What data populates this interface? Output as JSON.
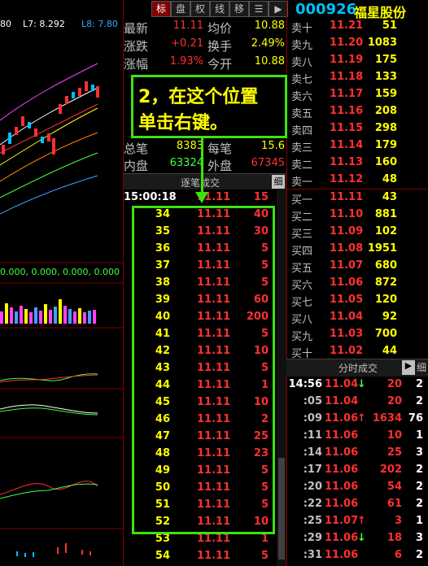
{
  "chart_header": {
    "v1": "80",
    "l7": "L7: 8.292",
    "l8": "L8: 7.80"
  },
  "chart_indicator_text": "0.000, 0.000, 0.000, 0.000",
  "toolbar": {
    "tabs": [
      "标",
      "盘",
      "权",
      "线",
      "移",
      "",
      ""
    ]
  },
  "stock": {
    "code": "000926",
    "name": "福星股份"
  },
  "quote": [
    {
      "l1": "最新",
      "v1": "11.11",
      "c1": "#ff3030",
      "l2": "均价",
      "v2": "10.88",
      "c2": "#ffff00"
    },
    {
      "l1": "涨跌",
      "v1": "+0.21",
      "c1": "#ff3030",
      "l2": "换手",
      "v2": "2.49%",
      "c2": "#ffff00"
    },
    {
      "l1": "涨幅",
      "v1": "1.93%",
      "c1": "#ff3030",
      "l2": "今开",
      "v2": "10.88",
      "c2": "#ffff00"
    },
    {
      "l1": "总笔",
      "v1": "8383",
      "c1": "#ffff00",
      "l2": "每笔",
      "v2": "15.6",
      "c2": "#ffff00"
    },
    {
      "l1": "内盘",
      "v1": "63324",
      "c1": "#40ff40",
      "l2": "外盘",
      "v2": "67345",
      "c2": "#ff3030"
    }
  ],
  "tick_header": {
    "title": "逐笔成交",
    "detail": "细"
  },
  "tick_first": {
    "time": "15:00:18",
    "price": "11.11",
    "vol": "15"
  },
  "ticks": [
    {
      "t": "34",
      "p": "11.11",
      "v": "40"
    },
    {
      "t": "35",
      "p": "11.11",
      "v": "30"
    },
    {
      "t": "36",
      "p": "11.11",
      "v": "5"
    },
    {
      "t": "37",
      "p": "11.11",
      "v": "5"
    },
    {
      "t": "38",
      "p": "11.11",
      "v": "5"
    },
    {
      "t": "39",
      "p": "11.11",
      "v": "60"
    },
    {
      "t": "40",
      "p": "11.11",
      "v": "200"
    },
    {
      "t": "41",
      "p": "11.11",
      "v": "5"
    },
    {
      "t": "42",
      "p": "11.11",
      "v": "10"
    },
    {
      "t": "43",
      "p": "11.11",
      "v": "5"
    },
    {
      "t": "44",
      "p": "11.11",
      "v": "1"
    },
    {
      "t": "45",
      "p": "11.11",
      "v": "10"
    },
    {
      "t": "46",
      "p": "11.11",
      "v": "2"
    },
    {
      "t": "47",
      "p": "11.11",
      "v": "25"
    },
    {
      "t": "48",
      "p": "11.11",
      "v": "23"
    },
    {
      "t": "49",
      "p": "11.11",
      "v": "5"
    },
    {
      "t": "50",
      "p": "11.11",
      "v": "5"
    },
    {
      "t": "51",
      "p": "11.11",
      "v": "5"
    },
    {
      "t": "52",
      "p": "11.11",
      "v": "10"
    },
    {
      "t": "53",
      "p": "11.11",
      "v": "1"
    },
    {
      "t": "54",
      "p": "11.11",
      "v": "5"
    }
  ],
  "orderbook": [
    {
      "label": "卖十",
      "price": "11.21",
      "vol": "51"
    },
    {
      "label": "卖九",
      "price": "11.20",
      "vol": "1083"
    },
    {
      "label": "卖八",
      "price": "11.19",
      "vol": "175"
    },
    {
      "label": "卖七",
      "price": "11.18",
      "vol": "133"
    },
    {
      "label": "卖六",
      "price": "11.17",
      "vol": "159"
    },
    {
      "label": "卖五",
      "price": "11.16",
      "vol": "208"
    },
    {
      "label": "卖四",
      "price": "11.15",
      "vol": "298"
    },
    {
      "label": "卖三",
      "price": "11.14",
      "vol": "179"
    },
    {
      "label": "卖二",
      "price": "11.13",
      "vol": "160"
    },
    {
      "label": "卖一",
      "price": "11.12",
      "vol": "48"
    },
    {
      "label": "买一",
      "price": "11.11",
      "vol": "43"
    },
    {
      "label": "买二",
      "price": "11.10",
      "vol": "881"
    },
    {
      "label": "买三",
      "price": "11.09",
      "vol": "102"
    },
    {
      "label": "买四",
      "price": "11.08",
      "vol": "1951"
    },
    {
      "label": "买五",
      "price": "11.07",
      "vol": "680"
    },
    {
      "label": "买六",
      "price": "11.06",
      "vol": "872"
    },
    {
      "label": "买七",
      "price": "11.05",
      "vol": "120"
    },
    {
      "label": "买八",
      "price": "11.04",
      "vol": "92"
    },
    {
      "label": "买九",
      "price": "11.03",
      "vol": "700"
    },
    {
      "label": "买十",
      "price": "11.02",
      "vol": "44"
    }
  ],
  "fenshi_header": {
    "title": "分时成交",
    "arrow": "▶",
    "detail": "细"
  },
  "fenshi": [
    {
      "t": "14:56",
      "p": "11.04",
      "a": "↓",
      "ac": "#40ff40",
      "v": "20",
      "n": "2"
    },
    {
      "t": ":05",
      "p": "11.04",
      "a": "",
      "ac": "#ff3030",
      "v": "20",
      "n": "2"
    },
    {
      "t": ":09",
      "p": "11.06",
      "a": "↑",
      "ac": "#ff3030",
      "v": "1634",
      "n": "76"
    },
    {
      "t": ":11",
      "p": "11.06",
      "a": "",
      "ac": "#ff3030",
      "v": "10",
      "n": "1"
    },
    {
      "t": ":14",
      "p": "11.06",
      "a": "",
      "ac": "#ff3030",
      "v": "25",
      "n": "3"
    },
    {
      "t": ":17",
      "p": "11.06",
      "a": "",
      "ac": "#ff3030",
      "v": "202",
      "n": "2"
    },
    {
      "t": ":20",
      "p": "11.06",
      "a": "",
      "ac": "#ff3030",
      "v": "54",
      "n": "2"
    },
    {
      "t": ":22",
      "p": "11.06",
      "a": "",
      "ac": "#ff3030",
      "v": "61",
      "n": "2"
    },
    {
      "t": ":25",
      "p": "11.07",
      "a": "↑",
      "ac": "#ff3030",
      "v": "3",
      "n": "1"
    },
    {
      "t": ":29",
      "p": "11.06",
      "a": "↓",
      "ac": "#40ff40",
      "v": "18",
      "n": "3"
    },
    {
      "t": ":31",
      "p": "11.06",
      "a": "",
      "ac": "#ff3030",
      "v": "6",
      "n": "2"
    }
  ],
  "annotation": {
    "line1": "2，在这个位置",
    "line2": "单击右键。"
  }
}
